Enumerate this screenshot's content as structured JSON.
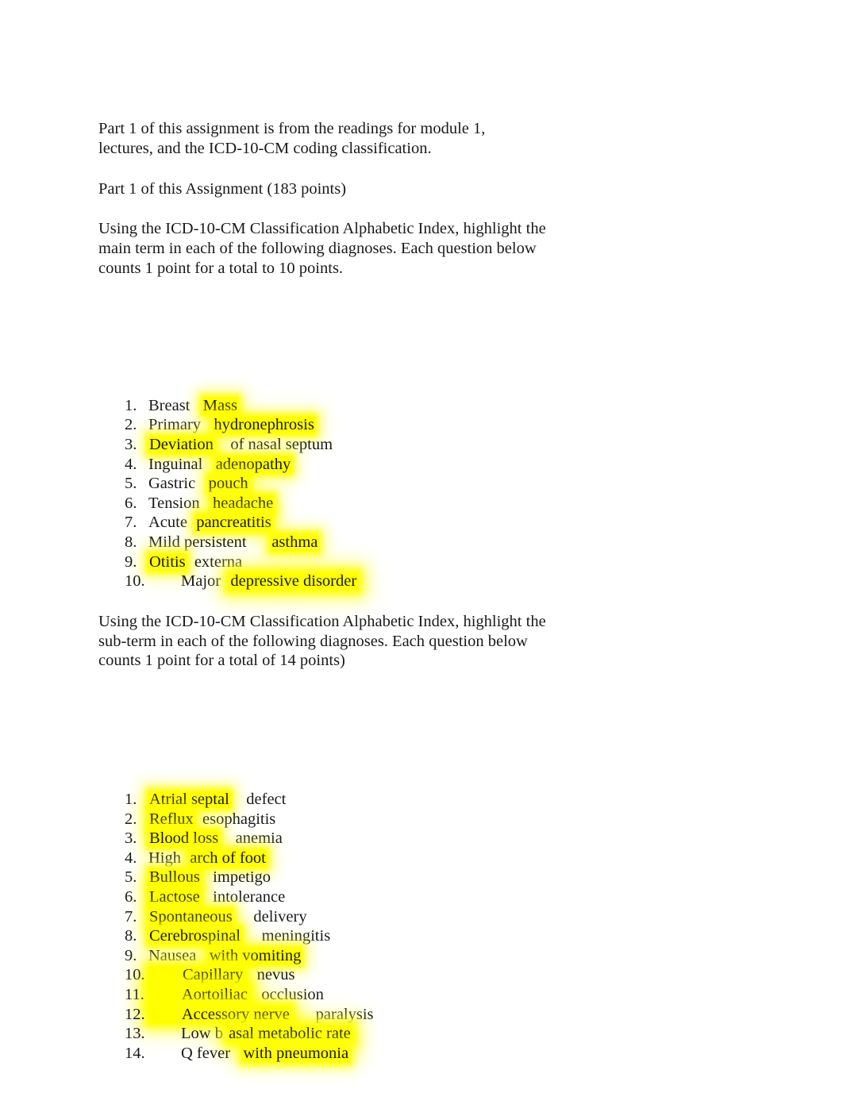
{
  "document": {
    "intro_paragraph": "Part 1 of this assignment is from the readings for module 1,\nlectures, and the ICD-10-CM coding classification.",
    "part_heading": "Part 1 of this Assignment (183 points)",
    "instruction_main_term": "Using the ICD-10-CM Classification Alphabetic Index, highlight the\nmain term in each of the following diagnoses. Each question below\ncounts 1 point for a total to 10 points.",
    "instruction_sub_term": "Using the ICD-10-CM Classification Alphabetic Index, highlight the\nsub-term in each of the following diagnoses. Each question below\ncounts 1 point for a total of 14 points)",
    "highlight_color": "#ffff00",
    "text_color": "#1a1a1a",
    "background_color": "#ffffff"
  },
  "main_term_list": {
    "items": [
      {
        "number": "1.",
        "pre": "Breast   ",
        "highlight": "Mass",
        "post": ""
      },
      {
        "number": "2.",
        "pre": "Primary   ",
        "highlight": "hydronephrosis",
        "post": ""
      },
      {
        "number": "3.",
        "pre": "",
        "highlight": "Deviation",
        "post": "    of nasal septum"
      },
      {
        "number": "4.",
        "pre": "Inguinal   ",
        "highlight": "adenopathy",
        "post": ""
      },
      {
        "number": "5.",
        "pre": "Gastric   ",
        "highlight": "pouch",
        "post": ""
      },
      {
        "number": "6.",
        "pre": "Tension   ",
        "highlight": "headache",
        "post": ""
      },
      {
        "number": "7.",
        "pre": "Acute  ",
        "highlight": "pancreatitis",
        "post": ""
      },
      {
        "number": "8.",
        "pre": "Mild persistent      ",
        "highlight": "asthma",
        "post": ""
      },
      {
        "number": "9.",
        "pre": "",
        "highlight": "Otitis",
        "post": "  externa"
      },
      {
        "number": "10.",
        "pre": "        Major  ",
        "highlight": "depressive disorder",
        "post": ""
      }
    ]
  },
  "sub_term_list": {
    "items": [
      {
        "number": "1.",
        "pre": "",
        "highlight": "Atrial septal",
        "post": "    defect"
      },
      {
        "number": "2.",
        "pre": "",
        "highlight": "Reflux",
        "post": "  esophagitis"
      },
      {
        "number": "3.",
        "pre": "",
        "highlight": "Blood loss",
        "post": "    anemia"
      },
      {
        "number": "4.",
        "pre": "High  ",
        "highlight": "arch of foot",
        "post": ""
      },
      {
        "number": "5.",
        "pre": "",
        "highlight": "Bullous",
        "post": "   impetigo"
      },
      {
        "number": "6.",
        "pre": "",
        "highlight": "Lactose",
        "post": "   intolerance"
      },
      {
        "number": "7.",
        "pre": "",
        "highlight": "Spontaneous",
        "post": "     delivery"
      },
      {
        "number": "8.",
        "pre": "",
        "highlight": "Cerebrospinal",
        "post": "     meningitis"
      },
      {
        "number": "9.",
        "pre": "Nausea   ",
        "highlight": "with vomiting",
        "post": ""
      },
      {
        "number": "10.",
        "pre": "",
        "highlight": "        Capillary",
        "post": "   nevus"
      },
      {
        "number": "11.",
        "pre": "",
        "highlight": "        Aortoiliac",
        "post": "   occlusion"
      },
      {
        "number": "12.",
        "pre": "",
        "highlight": "        Accessory nerve",
        "post": "      paralysis"
      },
      {
        "number": "13.",
        "pre": "        Low b ",
        "highlight": "asal metabolic rate",
        "post": ""
      },
      {
        "number": "14.",
        "pre": "        Q fever   ",
        "highlight": "with pneumonia",
        "post": ""
      }
    ]
  }
}
